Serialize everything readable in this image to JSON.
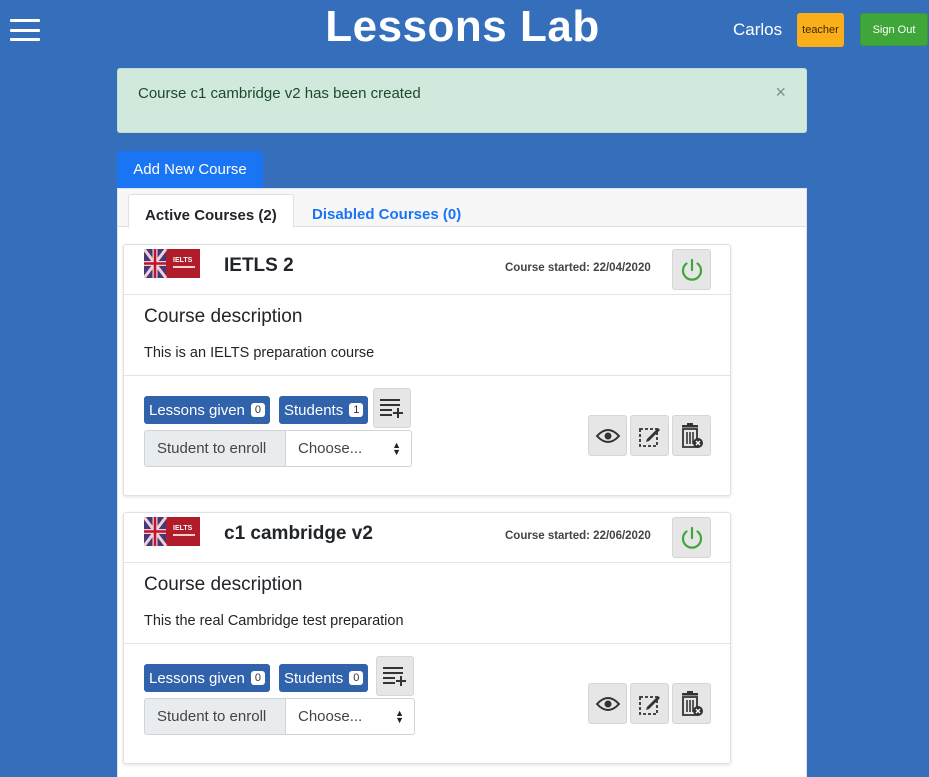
{
  "header": {
    "title": "Lessons Lab",
    "user_name": "Carlos",
    "role_badge": "teacher",
    "signout_label": "Sign Out"
  },
  "alert": {
    "message": "Course c1 cambridge v2 has been created",
    "close_symbol": "×"
  },
  "add_course_label": "Add New Course",
  "tabs": [
    {
      "label": "Active Courses (2)",
      "active": true
    },
    {
      "label": "Disabled Courses (0)",
      "active": false
    }
  ],
  "courses": [
    {
      "title": "IETLS 2",
      "started": "Course started: 22/04/2020",
      "thumbnail_caption": "IELTS",
      "description_title": "Course description",
      "description": "This is an IELTS preparation course",
      "lessons_label": "Lessons given",
      "lessons_count": "0",
      "students_label": "Students",
      "students_count": "1",
      "enroll_label": "Student to enroll",
      "enroll_select_value": "Choose..."
    },
    {
      "title": "c1 cambridge v2",
      "started": "Course started: 22/06/2020",
      "thumbnail_caption": "IELTS",
      "description_title": "Course description",
      "description": "This the real Cambridge test preparation",
      "lessons_label": "Lessons given",
      "lessons_count": "0",
      "students_label": "Students",
      "students_count": "0",
      "enroll_label": "Student to enroll",
      "enroll_select_value": "Choose..."
    }
  ],
  "icons": {
    "menu": "hamburger-icon",
    "power": "power-icon",
    "add_list": "playlist-add-icon",
    "view": "eye-icon",
    "edit": "edit-icon",
    "delete": "trash-icon"
  },
  "colors": {
    "background": "#356fbc",
    "primary": "#1a75f5",
    "badge_blue": "#3163ad",
    "teacher_badge": "#f9ae1a",
    "signout": "#3fa73a",
    "alert_bg": "#d1e8dc",
    "power_green": "#3fa73a"
  }
}
